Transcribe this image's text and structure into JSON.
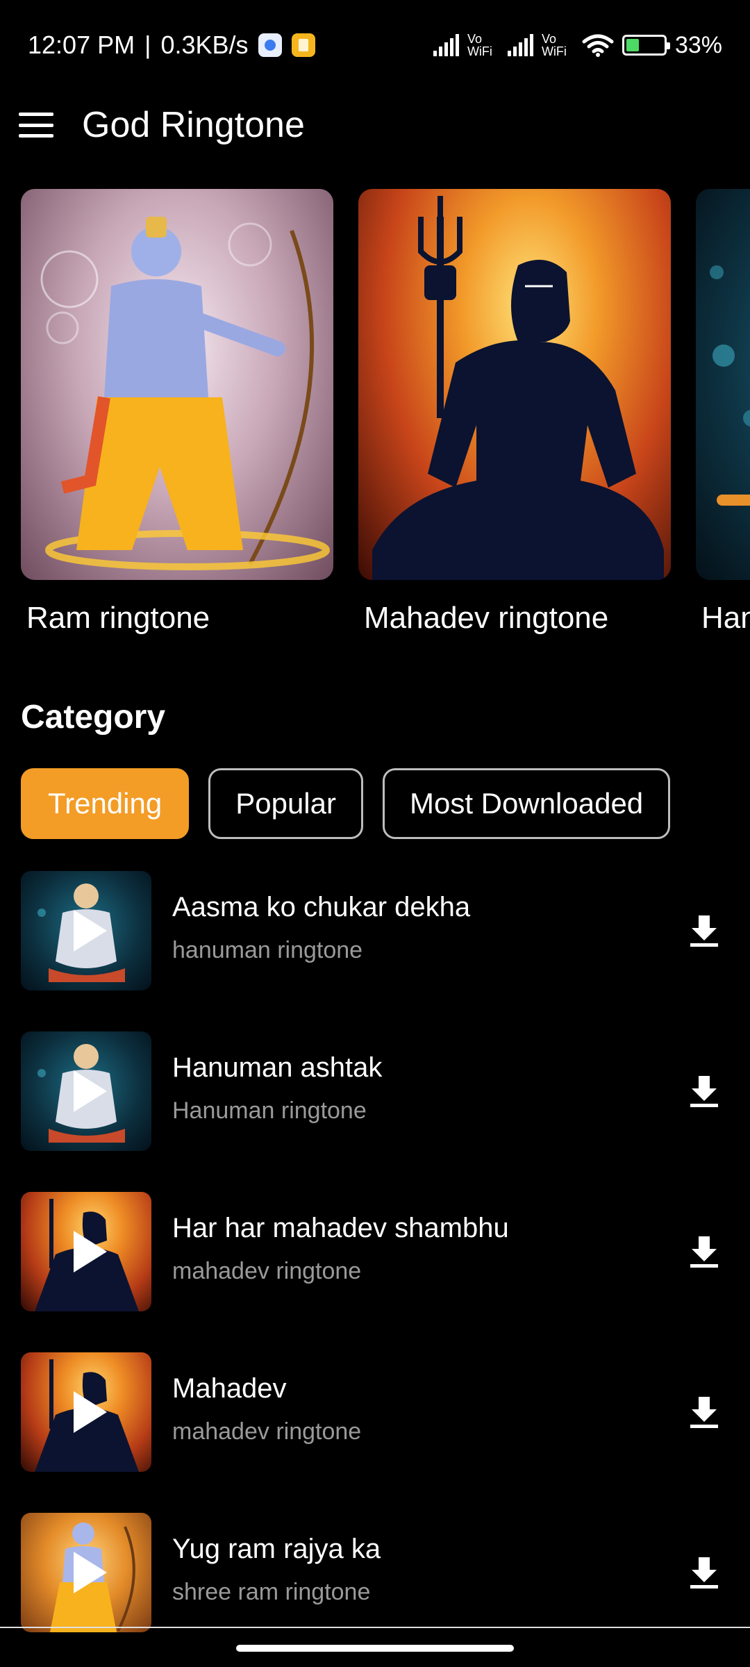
{
  "status_bar": {
    "time": "12:07 PM",
    "separator": "|",
    "speed": "0.3KB/s",
    "vowifi_1": "Vo WiFi",
    "vowifi_2": "Vo WiFi",
    "battery": "33%"
  },
  "app_bar": {
    "title": "God Ringtone"
  },
  "carousel": {
    "items": [
      {
        "label": "Ram ringtone",
        "icon": "ram-image"
      },
      {
        "label": "Mahadev ringtone",
        "icon": "mahadev-image"
      },
      {
        "label": "Hanuman ringtone",
        "icon": "hanuman-image"
      }
    ]
  },
  "category": {
    "title": "Category",
    "chips": [
      {
        "label": "Trending",
        "active": true
      },
      {
        "label": "Popular",
        "active": false
      },
      {
        "label": "Most Downloaded",
        "active": false
      }
    ]
  },
  "ringtones": [
    {
      "title": "Aasma ko chukar dekha",
      "subtitle": "hanuman ringtone",
      "thumb": "hanuman"
    },
    {
      "title": "Hanuman ashtak",
      "subtitle": "Hanuman ringtone",
      "thumb": "hanuman"
    },
    {
      "title": "Har har mahadev shambhu",
      "subtitle": "mahadev ringtone",
      "thumb": "mahadev"
    },
    {
      "title": "Mahadev",
      "subtitle": "mahadev ringtone",
      "thumb": "mahadev"
    },
    {
      "title": "Yug ram rajya ka",
      "subtitle": "shree ram ringtone",
      "thumb": "ram"
    }
  ],
  "colors": {
    "background": "#000000",
    "accent": "#f39c26",
    "subtitle": "#9a9a9a"
  }
}
